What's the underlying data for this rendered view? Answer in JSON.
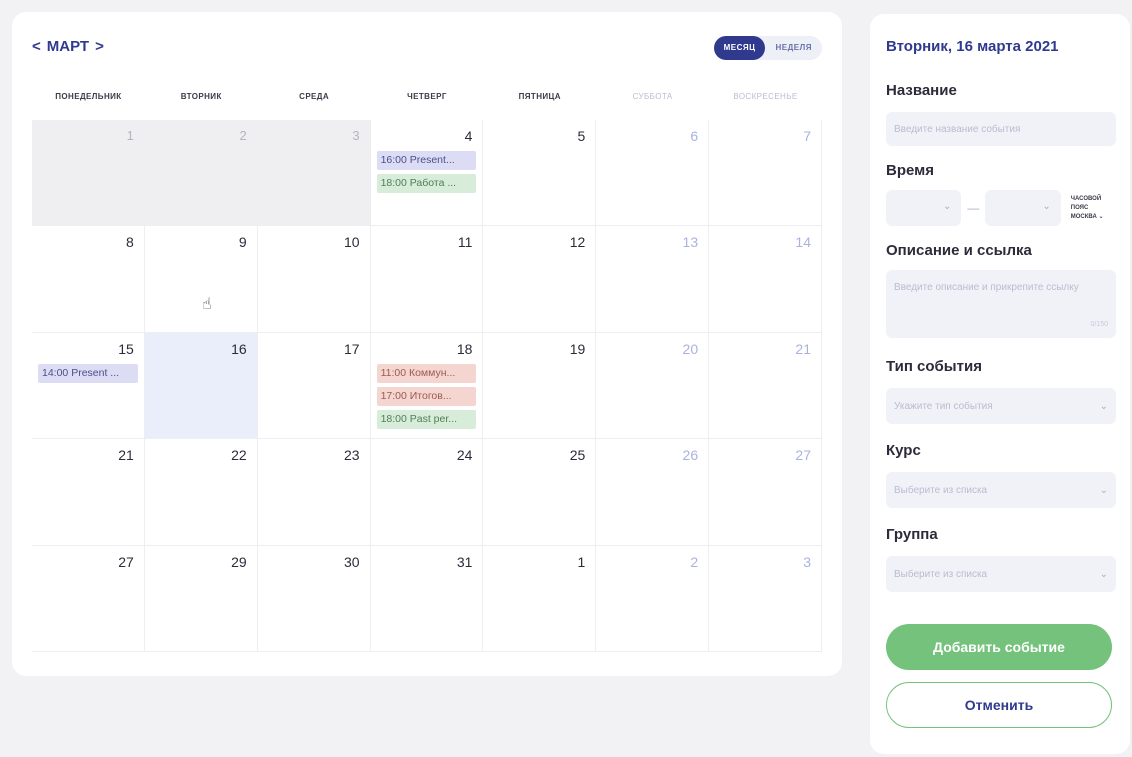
{
  "calendar": {
    "month_label": "МАРТ",
    "prev_icon": "chevron-left-icon",
    "next_icon": "chevron-right-icon",
    "view_month": "МЕСЯЦ",
    "view_week": "НЕДЕЛЯ",
    "weekdays": [
      "ПОНЕДЕЛЬНИК",
      "ВТОРНИК",
      "СРЕДА",
      "ЧЕТВЕРГ",
      "ПЯТНИЦА",
      "СУББОТА",
      "ВОСКРЕСЕНЬЕ"
    ],
    "weeks": [
      [
        {
          "day": "1",
          "state": "prev"
        },
        {
          "day": "2",
          "state": "prev"
        },
        {
          "day": "3",
          "state": "prev"
        },
        {
          "day": "4",
          "state": "",
          "events": [
            {
              "text": "16:00 Present...",
              "color": "purple"
            },
            {
              "text": "18:00 Работа ...",
              "color": "green"
            }
          ]
        },
        {
          "day": "5",
          "state": ""
        },
        {
          "day": "6",
          "state": "weekend"
        },
        {
          "day": "7",
          "state": "weekend"
        }
      ],
      [
        {
          "day": "8",
          "state": ""
        },
        {
          "day": "9",
          "state": ""
        },
        {
          "day": "10",
          "state": ""
        },
        {
          "day": "11",
          "state": ""
        },
        {
          "day": "12",
          "state": ""
        },
        {
          "day": "13",
          "state": "weekend"
        },
        {
          "day": "14",
          "state": "weekend"
        }
      ],
      [
        {
          "day": "15",
          "state": "",
          "events": [
            {
              "text": "14:00 Present ...",
              "color": "purple"
            }
          ]
        },
        {
          "day": "16",
          "state": "today"
        },
        {
          "day": "17",
          "state": ""
        },
        {
          "day": "18",
          "state": "",
          "events": [
            {
              "text": "11:00 Коммун...",
              "color": "red"
            },
            {
              "text": "17:00 Итогов...",
              "color": "red"
            },
            {
              "text": "18:00 Past per...",
              "color": "green"
            }
          ]
        },
        {
          "day": "19",
          "state": ""
        },
        {
          "day": "20",
          "state": "weekend"
        },
        {
          "day": "21",
          "state": "weekend"
        }
      ],
      [
        {
          "day": "21",
          "state": ""
        },
        {
          "day": "22",
          "state": ""
        },
        {
          "day": "23",
          "state": ""
        },
        {
          "day": "24",
          "state": ""
        },
        {
          "day": "25",
          "state": ""
        },
        {
          "day": "26",
          "state": "weekend"
        },
        {
          "day": "27",
          "state": "weekend"
        }
      ],
      [
        {
          "day": "27",
          "state": ""
        },
        {
          "day": "29",
          "state": ""
        },
        {
          "day": "30",
          "state": ""
        },
        {
          "day": "31",
          "state": ""
        },
        {
          "day": "1",
          "state": "nextm"
        },
        {
          "day": "2",
          "state": "weekend nextm"
        },
        {
          "day": "3",
          "state": "weekend nextm"
        }
      ]
    ]
  },
  "form": {
    "date_title": "Вторник, 16 марта 2021",
    "name_label": "Название",
    "name_placeholder": "Введите название события",
    "time_label": "Время",
    "time_dash": "—",
    "tz_line1": "ЧАСОВОЙ ПОЯС",
    "tz_line2": "МОСКВА ⌄",
    "desc_label": "Описание и ссылка",
    "desc_placeholder": "Введите описание и прикрепите ссылку",
    "desc_counter": "0/150",
    "type_label": "Тип события",
    "type_placeholder": "Укажите тип события",
    "course_label": "Курс",
    "course_placeholder": "Выберите из списка",
    "group_label": "Группа",
    "group_placeholder": "Выберите из списка",
    "add_button": "Добавить событие",
    "cancel_button": "Отменить"
  },
  "colors": {
    "accent": "#2f3a8f",
    "success": "#74c27c",
    "event_purple": "#dcdcf5",
    "event_green": "#d7ecd9",
    "event_red": "#f5d5d0"
  }
}
